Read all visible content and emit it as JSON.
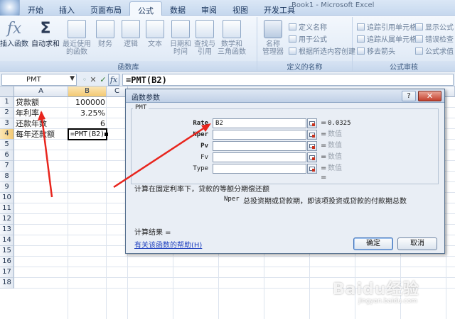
{
  "app": {
    "title": "Book1 - Microsoft Excel"
  },
  "tabs": [
    {
      "label": "开始",
      "active": false
    },
    {
      "label": "插入",
      "active": false
    },
    {
      "label": "页面布局",
      "active": false
    },
    {
      "label": "公式",
      "active": true
    },
    {
      "label": "数据",
      "active": false
    },
    {
      "label": "审阅",
      "active": false
    },
    {
      "label": "视图",
      "active": false
    },
    {
      "label": "开发工具",
      "active": false
    }
  ],
  "ribbon": {
    "function_library": {
      "title": "函数库",
      "insert_function": "插入函数",
      "autosum_line1": "自动求和",
      "recent_line1": "最近使用",
      "recent_line2": "的函数",
      "financial": "财务",
      "logical": "逻辑",
      "text": "文本",
      "datetime_line1": "日期和",
      "datetime_line2": "时间",
      "lookup_line1": "查找与",
      "lookup_line2": "引用",
      "math_line1": "数学和",
      "math_line2": "三角函数",
      "more_line1": "其他函数"
    },
    "defined_names": {
      "title": "定义的名称",
      "name_manager_line1": "名称",
      "name_manager_line2": "管理器",
      "define_name": "定义名称",
      "use_in_formula": "用于公式",
      "create_from_selection": "根据所选内容创建"
    },
    "formula_auditing": {
      "title": "公式审核",
      "trace_precedents": "追踪引用单元格",
      "trace_dependents": "追踪从属单元格",
      "remove_arrows": "移去箭头",
      "show_formulas": "显示公式",
      "error_checking": "错误检查",
      "evaluate_formula": "公式求值"
    }
  },
  "formula_bar": {
    "name_box": "PMT",
    "formula": "=PMT(B2)",
    "fx": "fx",
    "cancel_glyph": "✕",
    "enter_glyph": "✓"
  },
  "sheet": {
    "columns": [
      "A",
      "B",
      "C"
    ],
    "rows": [
      "1",
      "2",
      "3",
      "4",
      "5",
      "6",
      "7",
      "8",
      "9",
      "10",
      "11",
      "12",
      "13",
      "14",
      "15",
      "16",
      "17",
      "18"
    ],
    "cells": {
      "A1": "贷款额",
      "B1": "100000",
      "A2": "年利率",
      "B2": "3.25%",
      "A3": "还款年数",
      "B3": "6",
      "A4": "每年还款额",
      "B4": "=PMT(B2)"
    }
  },
  "dialog": {
    "title": "函数参数",
    "help_glyph": "?",
    "close_glyph": "✕",
    "function_name": "PMT",
    "args": [
      {
        "name": "Rate",
        "value": "B2",
        "result": "0.0325",
        "has_value": true
      },
      {
        "name": "Nper",
        "value": "",
        "result": "数值",
        "has_value": false
      },
      {
        "name": "Pv",
        "value": "",
        "result": "数值",
        "has_value": false
      },
      {
        "name": "Fv",
        "value": "",
        "result": "数值",
        "has_value": false
      },
      {
        "name": "Type",
        "value": "",
        "result": "数值",
        "has_value": false
      }
    ],
    "equals": "=",
    "description": "计算在固定利率下，贷款的等额分期偿还额",
    "arg_desc_name": "Nper",
    "arg_desc": "总投资期或贷款期，即该项投资或贷款的付款期总数",
    "calc_result_label": "计算结果 =",
    "help_link": "有关该函数的帮助(H)",
    "ok": "确定",
    "cancel": "取消"
  },
  "annotations": {
    "arrow_color": "#e8251d",
    "watermark": "Baidu经验",
    "watermark_sub": "jingyan.baidu.com"
  }
}
